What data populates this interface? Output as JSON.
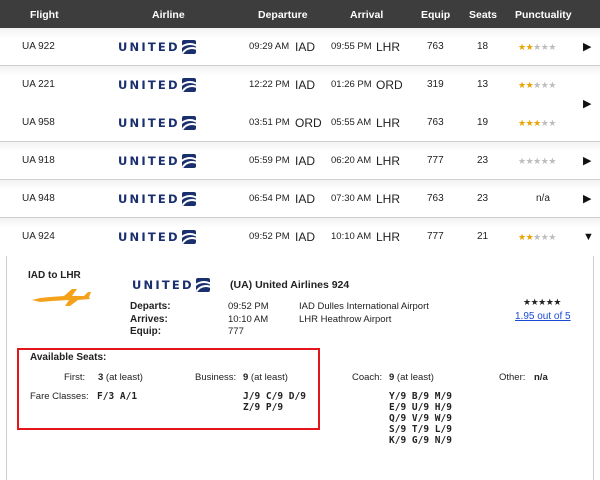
{
  "header": {
    "flight": "Flight",
    "airline": "Airline",
    "departure": "Departure",
    "arrival": "Arrival",
    "equip": "Equip",
    "seats": "Seats",
    "punctuality": "Punctuality"
  },
  "airline_logo_text": "UNITED",
  "colors": {
    "header_bg": "#3d3d3d",
    "united_blue": "#1a2f6e",
    "star": "#e9a400",
    "highlight_border": "#e4161b",
    "link": "#1a4bd6"
  },
  "flights": [
    {
      "flight": "UA 922",
      "dep_time": "09:29 AM",
      "dep_code": "IAD",
      "arr_time": "09:55 PM",
      "arr_code": "LHR",
      "equip": "763",
      "seats": "18",
      "stars": 2,
      "punctuality_text": "",
      "arrow": "▶"
    },
    {
      "flight": "UA 221",
      "dep_time": "12:22 PM",
      "dep_code": "IAD",
      "arr_time": "01:26 PM",
      "arr_code": "ORD",
      "equip": "319",
      "seats": "13",
      "stars": 2,
      "punctuality_text": "",
      "arrow": ""
    },
    {
      "flight": "UA 958",
      "dep_time": "03:51 PM",
      "dep_code": "ORD",
      "arr_time": "05:55 AM",
      "arr_code": "LHR",
      "equip": "763",
      "seats": "19",
      "stars": 3,
      "punctuality_text": "",
      "arrow": ""
    },
    {
      "flight": "UA 918",
      "dep_time": "05:59 PM",
      "dep_code": "IAD",
      "arr_time": "06:20 AM",
      "arr_code": "LHR",
      "equip": "777",
      "seats": "23",
      "stars": 0,
      "punctuality_text": "",
      "arrow": "▶"
    },
    {
      "flight": "UA 948",
      "dep_time": "06:54 PM",
      "dep_code": "IAD",
      "arr_time": "07:30 AM",
      "arr_code": "LHR",
      "equip": "763",
      "seats": "23",
      "stars": null,
      "punctuality_text": "n/a",
      "arrow": "▶"
    },
    {
      "flight": "UA 924",
      "dep_time": "09:52 PM",
      "dep_code": "IAD",
      "arr_time": "10:10 AM",
      "arr_code": "LHR",
      "equip": "777",
      "seats": "21",
      "stars": 2,
      "punctuality_text": "",
      "arrow": "▼"
    }
  ],
  "connection_arrow": "▶",
  "detail": {
    "route": "IAD to LHR",
    "airline_name": "(UA) United Airlines 924",
    "departs_label": "Departs:",
    "departs_time": "09:52 PM",
    "departs_airport": "IAD Dulles International Airport",
    "arrives_label": "Arrives:",
    "arrives_time": "10:10 AM",
    "arrives_airport": "LHR Heathrow Airport",
    "equip_label": "Equip:",
    "equip_value": "777",
    "stars": 2,
    "rating_link": "1.95 out of 5",
    "available_seats_title": "Available Seats:",
    "first_label": "First:",
    "first_value": "3 (at least)",
    "business_label": "Business:",
    "business_value": "9 (at least)",
    "coach_label": "Coach:",
    "coach_value": "9 (at least)",
    "other_label": "Other:",
    "other_value": "n/a",
    "fare_classes_label": "Fare Classes:",
    "first_fares": "F/3 A/1",
    "business_fares": [
      "J/9 C/9 D/9",
      "Z/9 P/9"
    ],
    "coach_fares": [
      "Y/9 B/9 M/9",
      "E/9 U/9 H/9",
      "Q/9 V/9 W/9",
      "S/9 T/9 L/9",
      "K/9 G/9 N/9"
    ]
  }
}
